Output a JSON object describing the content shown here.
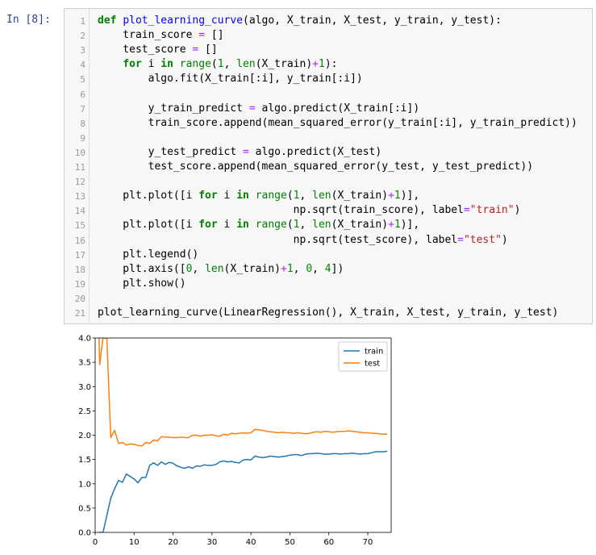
{
  "cell": {
    "prompt": "In [8]:",
    "lines": [
      [
        [
          "def",
          "kw"
        ],
        [
          " ",
          ""
        ],
        [
          "plot_learning_curve",
          "fn"
        ],
        [
          "(algo, X_train, X_test, y_train, y_test):",
          ""
        ]
      ],
      [
        [
          "    train_score ",
          ""
        ],
        [
          "=",
          "op"
        ],
        [
          " []",
          ""
        ]
      ],
      [
        [
          "    test_score ",
          ""
        ],
        [
          "=",
          "op"
        ],
        [
          " []",
          ""
        ]
      ],
      [
        [
          "    ",
          ""
        ],
        [
          "for",
          "kw"
        ],
        [
          " i ",
          ""
        ],
        [
          "in",
          "kw"
        ],
        [
          " ",
          ""
        ],
        [
          "range",
          "bi"
        ],
        [
          "(",
          ""
        ],
        [
          "1",
          "num"
        ],
        [
          ", ",
          ""
        ],
        [
          "len",
          "bi"
        ],
        [
          "(X_train)",
          ""
        ],
        [
          "+",
          "op"
        ],
        [
          "1",
          "num"
        ],
        [
          "):",
          ""
        ]
      ],
      [
        [
          "        algo.fit(X_train[:i], y_train[:i])",
          ""
        ]
      ],
      [],
      [
        [
          "        y_train_predict ",
          ""
        ],
        [
          "=",
          "op"
        ],
        [
          " algo.predict(X_train[:i])",
          ""
        ]
      ],
      [
        [
          "        train_score.append(mean_squared_error(y_train[:i], y_train_predict))",
          ""
        ]
      ],
      [],
      [
        [
          "        y_test_predict ",
          ""
        ],
        [
          "=",
          "op"
        ],
        [
          " algo.predict(X_test)",
          ""
        ]
      ],
      [
        [
          "        test_score.append(mean_squared_error(y_test, y_test_predict))",
          ""
        ]
      ],
      [],
      [
        [
          "    plt.plot([i ",
          ""
        ],
        [
          "for",
          "kw"
        ],
        [
          " i ",
          ""
        ],
        [
          "in",
          "kw"
        ],
        [
          " ",
          ""
        ],
        [
          "range",
          "bi"
        ],
        [
          "(",
          ""
        ],
        [
          "1",
          "num"
        ],
        [
          ", ",
          ""
        ],
        [
          "len",
          "bi"
        ],
        [
          "(X_train)",
          ""
        ],
        [
          "+",
          "op"
        ],
        [
          "1",
          "num"
        ],
        [
          ")],",
          ""
        ]
      ],
      [
        [
          "                               np.sqrt(train_score), label",
          ""
        ],
        [
          "=",
          "op"
        ],
        [
          "\"train\"",
          "str"
        ],
        [
          ")",
          ""
        ]
      ],
      [
        [
          "    plt.plot([i ",
          ""
        ],
        [
          "for",
          "kw"
        ],
        [
          " i ",
          ""
        ],
        [
          "in",
          "kw"
        ],
        [
          " ",
          ""
        ],
        [
          "range",
          "bi"
        ],
        [
          "(",
          ""
        ],
        [
          "1",
          "num"
        ],
        [
          ", ",
          ""
        ],
        [
          "len",
          "bi"
        ],
        [
          "(X_train)",
          ""
        ],
        [
          "+",
          "op"
        ],
        [
          "1",
          "num"
        ],
        [
          ")],",
          ""
        ]
      ],
      [
        [
          "                               np.sqrt(test_score), label",
          ""
        ],
        [
          "=",
          "op"
        ],
        [
          "\"test\"",
          "str"
        ],
        [
          ")",
          ""
        ]
      ],
      [
        [
          "    plt.legend()",
          ""
        ]
      ],
      [
        [
          "    plt.axis([",
          ""
        ],
        [
          "0",
          "num"
        ],
        [
          ", ",
          ""
        ],
        [
          "len",
          "bi"
        ],
        [
          "(X_train)",
          ""
        ],
        [
          "+",
          "op"
        ],
        [
          "1",
          "num"
        ],
        [
          ", ",
          ""
        ],
        [
          "0",
          "num"
        ],
        [
          ", ",
          ""
        ],
        [
          "4",
          "num"
        ],
        [
          "])",
          ""
        ]
      ],
      [
        [
          "    plt.show()",
          ""
        ]
      ],
      [],
      [
        [
          "plot_learning_curve(LinearRegression(), X_train, X_test, y_train, y_test)",
          ""
        ]
      ]
    ]
  },
  "chart_data": {
    "type": "line",
    "xlim": [
      0,
      76
    ],
    "ylim": [
      0,
      4
    ],
    "xticks": [
      0,
      10,
      20,
      30,
      40,
      50,
      60,
      70
    ],
    "yticks": [
      "0.0",
      "0.5",
      "1.0",
      "1.5",
      "2.0",
      "2.5",
      "3.0",
      "3.5",
      "4.0"
    ],
    "legend_position": "top-right",
    "grid": false,
    "series": [
      {
        "name": "train",
        "color": "#1f77b4",
        "x": [
          1,
          2,
          3,
          4,
          5,
          6,
          7,
          8,
          9,
          10,
          11,
          12,
          13,
          14,
          15,
          16,
          17,
          18,
          19,
          20,
          21,
          22,
          23,
          24,
          25,
          26,
          27,
          28,
          29,
          30,
          31,
          32,
          33,
          34,
          35,
          36,
          37,
          38,
          39,
          40,
          41,
          42,
          43,
          44,
          45,
          46,
          47,
          48,
          49,
          50,
          51,
          52,
          53,
          54,
          55,
          56,
          57,
          58,
          59,
          60,
          61,
          62,
          63,
          64,
          65,
          66,
          67,
          68,
          69,
          70,
          71,
          72,
          73,
          74,
          75
        ],
        "y": [
          0.0,
          0.0,
          0.35,
          0.7,
          0.9,
          1.07,
          1.03,
          1.2,
          1.15,
          1.1,
          1.02,
          1.13,
          1.13,
          1.38,
          1.43,
          1.38,
          1.45,
          1.4,
          1.44,
          1.42,
          1.37,
          1.34,
          1.32,
          1.35,
          1.32,
          1.37,
          1.36,
          1.39,
          1.38,
          1.38,
          1.4,
          1.45,
          1.47,
          1.45,
          1.46,
          1.44,
          1.43,
          1.49,
          1.5,
          1.49,
          1.57,
          1.55,
          1.54,
          1.55,
          1.57,
          1.56,
          1.55,
          1.56,
          1.57,
          1.59,
          1.6,
          1.6,
          1.58,
          1.61,
          1.62,
          1.62,
          1.63,
          1.62,
          1.61,
          1.61,
          1.62,
          1.62,
          1.61,
          1.62,
          1.62,
          1.63,
          1.62,
          1.61,
          1.62,
          1.62,
          1.64,
          1.66,
          1.66,
          1.66,
          1.67
        ]
      },
      {
        "name": "test",
        "color": "#ff7f0e",
        "x": [
          1,
          1.15,
          2,
          2.6,
          3,
          4,
          5,
          6,
          7,
          8,
          9,
          10,
          11,
          12,
          13,
          14,
          15,
          16,
          17,
          18,
          19,
          20,
          21,
          22,
          23,
          24,
          25,
          26,
          27,
          28,
          29,
          30,
          31,
          32,
          33,
          34,
          35,
          36,
          37,
          38,
          39,
          40,
          41,
          42,
          43,
          44,
          45,
          46,
          47,
          48,
          49,
          50,
          51,
          52,
          53,
          54,
          55,
          56,
          57,
          58,
          59,
          60,
          61,
          62,
          63,
          64,
          65,
          66,
          67,
          68,
          69,
          70,
          71,
          72,
          73,
          74,
          75
        ],
        "y": [
          4.0,
          3.45,
          4.0,
          4.0,
          4.0,
          1.95,
          2.1,
          1.83,
          1.85,
          1.8,
          1.82,
          1.81,
          1.79,
          1.78,
          1.85,
          1.83,
          1.9,
          1.88,
          1.97,
          1.96,
          1.96,
          1.95,
          1.95,
          1.96,
          1.95,
          1.95,
          2.0,
          2.0,
          1.98,
          2.0,
          2.0,
          2.01,
          1.99,
          1.98,
          2.02,
          2.0,
          2.04,
          2.03,
          2.04,
          2.05,
          2.04,
          2.05,
          2.12,
          2.11,
          2.1,
          2.08,
          2.07,
          2.06,
          2.05,
          2.06,
          2.05,
          2.05,
          2.04,
          2.05,
          2.04,
          2.03,
          2.04,
          2.06,
          2.07,
          2.06,
          2.08,
          2.07,
          2.06,
          2.07,
          2.08,
          2.08,
          2.09,
          2.08,
          2.07,
          2.06,
          2.05,
          2.05,
          2.04,
          2.04,
          2.03,
          2.02,
          2.02
        ]
      }
    ]
  }
}
